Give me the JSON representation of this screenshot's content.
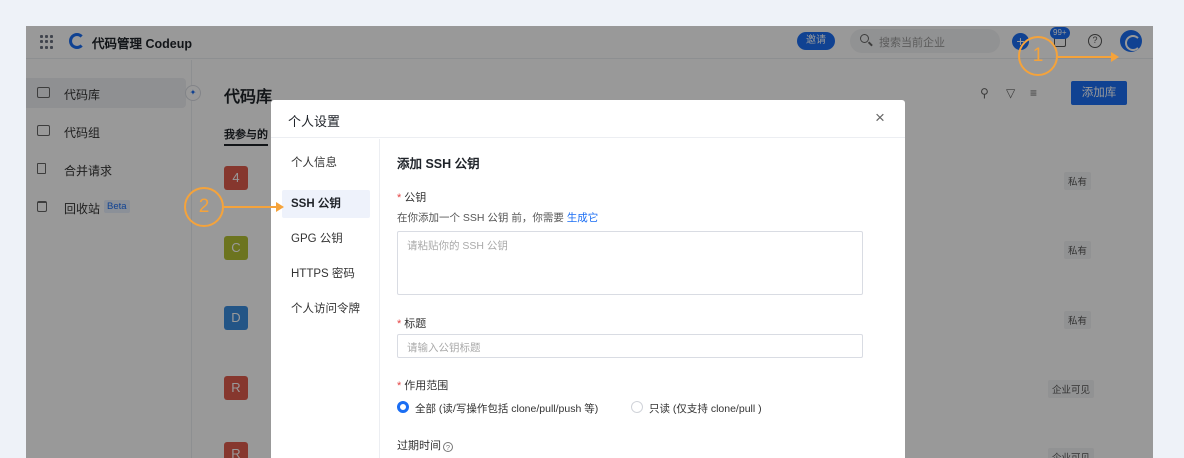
{
  "topbar": {
    "app_title": "代码管理 Codeup",
    "invite_label": "邀请",
    "search_placeholder": "搜索当前企业",
    "notification_badge": "99+",
    "help_label": "?"
  },
  "sidebar": {
    "items": [
      {
        "label": "代码库",
        "icon": "repo-icon"
      },
      {
        "label": "代码组",
        "icon": "folder-icon"
      },
      {
        "label": "合并请求",
        "icon": "merge-request-icon"
      },
      {
        "label": "回收站",
        "icon": "trash-icon",
        "badge": "Beta"
      }
    ]
  },
  "main": {
    "title": "代码库",
    "tab_label": "我参与的",
    "add_button_label": "添加库",
    "repos": [
      {
        "initial": "4",
        "color": "#e05c4e",
        "visibility": "私有"
      },
      {
        "initial": "C",
        "color": "#b5c234",
        "visibility": "私有"
      },
      {
        "initial": "D",
        "color": "#3b8ee0",
        "visibility": "私有"
      },
      {
        "initial": "R",
        "color": "#e05c4e",
        "visibility": "企业可见"
      },
      {
        "initial": "R",
        "color": "#e05c4e",
        "visibility": "企业可见"
      }
    ]
  },
  "modal": {
    "title": "个人设置",
    "close_label": "×",
    "nav": [
      "个人信息",
      "SSH 公钥",
      "GPG 公钥",
      "HTTPS 密码",
      "个人访问令牌"
    ],
    "section_title": "添加 SSH 公钥",
    "key_label": "公钥",
    "required_mark": "*",
    "hint_text": "在你添加一个 SSH 公钥 前，你需要 ",
    "hint_link": "生成它",
    "key_placeholder": "请粘贴你的 SSH 公钥",
    "title_label": "标题",
    "title_placeholder": "请输入公钥标题",
    "scope_label": "作用范围",
    "scope_options": [
      "全部 (读/写操作包括 clone/pull/push 等)",
      "只读 (仅支持 clone/pull )"
    ],
    "expire_label": "过期时间"
  },
  "callouts": [
    "1",
    "2"
  ],
  "colors": {
    "accent": "#1b6ef3",
    "callout": "#f5a33b"
  }
}
